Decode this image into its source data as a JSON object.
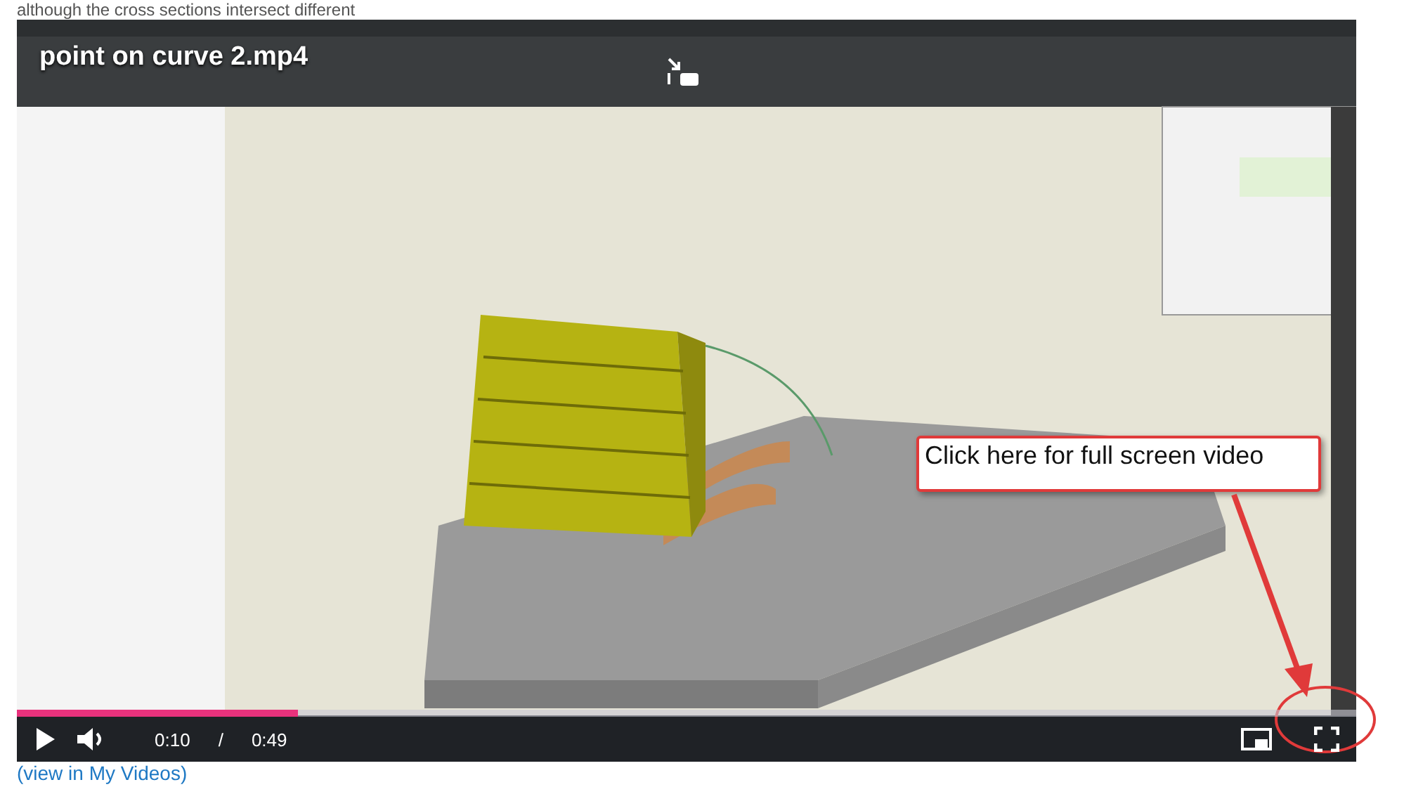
{
  "intro_text": "although the cross sections intersect different",
  "video": {
    "title": "point on curve 2.mp4",
    "progress": {
      "level": 0.21
    },
    "current_time": "0:10",
    "separator": "/",
    "duration": "0:49",
    "annotation": {
      "text": "Click here for full screen video"
    }
  },
  "link": "(view in My Videos)"
}
